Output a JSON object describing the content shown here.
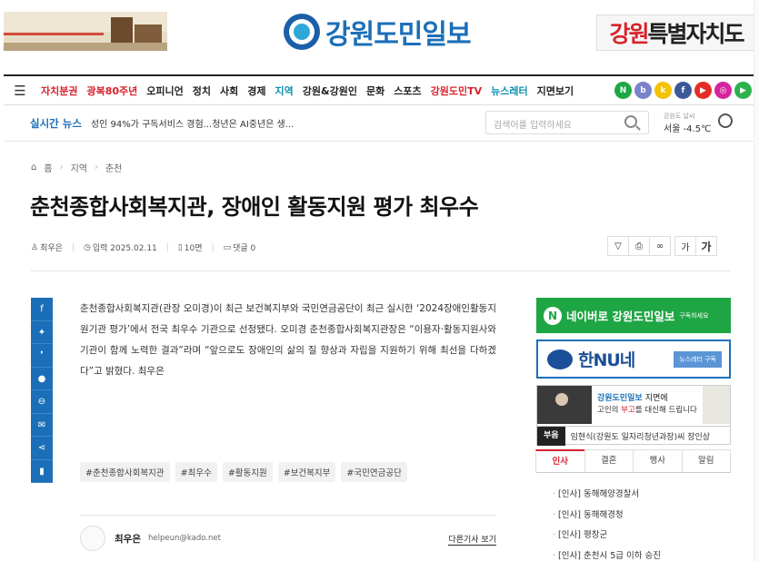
{
  "banners": {
    "left_caption": "",
    "right_text_red": "강원",
    "right_text": "특별자치도"
  },
  "logo": {
    "name": "강원도민일보"
  },
  "nav": {
    "menu": [
      {
        "label": "자치분권",
        "tone": "red"
      },
      {
        "label": "광복80주년",
        "tone": "red"
      },
      {
        "label": "오피니언",
        "tone": "dark"
      },
      {
        "label": "정치",
        "tone": "dark"
      },
      {
        "label": "사회",
        "tone": "dark"
      },
      {
        "label": "경제",
        "tone": "dark"
      },
      {
        "label": "지역",
        "tone": "teal"
      },
      {
        "label": "강원&강원인",
        "tone": "dark"
      },
      {
        "label": "문화",
        "tone": "dark"
      },
      {
        "label": "스포츠",
        "tone": "dark"
      },
      {
        "label": "강원도민TV",
        "tone": "red"
      },
      {
        "label": "뉴스레터",
        "tone": "teal"
      },
      {
        "label": "지면보기",
        "tone": "dark"
      }
    ],
    "socials": [
      {
        "icon": "naver-icon",
        "glyph": "N",
        "color": "#1fa644"
      },
      {
        "icon": "band-icon",
        "glyph": "b",
        "color": "#7a83c9"
      },
      {
        "icon": "kakaostory-icon",
        "glyph": "k",
        "color": "#f3c200"
      },
      {
        "icon": "facebook-icon",
        "glyph": "f",
        "color": "#3b5998"
      },
      {
        "icon": "youtube-icon",
        "glyph": "▶",
        "color": "#e52d27"
      },
      {
        "icon": "instagram-icon",
        "glyph": "◎",
        "color": "#d6249f"
      },
      {
        "icon": "play-icon",
        "glyph": "▶",
        "color": "#2bb24c"
      }
    ]
  },
  "ticker": {
    "label": "실시간 뉴스",
    "headline": "성인 94%가 구독서비스 경험...청년은 AI중년은 생...",
    "search_placeholder": "검색어를 입력하세요",
    "weather_small": "강원도 날씨",
    "weather": "서울 -4.5℃"
  },
  "breadcrumb": {
    "home": "홈",
    "section": "지역",
    "sub": "춘천"
  },
  "article": {
    "title": "춘천종합사회복지관, 장애인 활동지원 평가 최우수",
    "reporter": "최우은",
    "date": "입력 2025.02.11",
    "minutes": "10면",
    "comments": "댓글 0",
    "body": "춘천종합사회복지관(관장 오미경)이 최근 보건복지부와 국민연금공단이 최근 실시한 ‘2024장애인활동지원기관 평가’에서 전국 최우수 기관으로 선정됐다. 오미경 춘천종합사회복지관장은 “이용자·활동지원사와 기관이 함께 노력한 결과”라며 “앞으로도 장애인의 삶의 질 향상과 자립을 지원하기 위해 최선을 다하겠다”고 밝혔다. 최우은",
    "tags": [
      "#춘천종합사회복지관",
      "#최우수",
      "#활동지원",
      "#보건복지부",
      "#국민연금공단"
    ],
    "author_name": "최우은",
    "author_email": "helpeun@kado.net",
    "more_link": "다른기사 보기"
  },
  "tools": {
    "font_small": "가",
    "font_large": "가"
  },
  "sidebar": {
    "naver_title": "네이버로 강원도민일보",
    "naver_sub": "구독하세요",
    "hannune": "한NU네",
    "hannune_btn": "뉴스레터 구독",
    "obit_brand": "강원도민일보",
    "obit_line1": "지면에",
    "obit_line2_a": "고인의 ",
    "obit_line2_b": "부고",
    "obit_line2_c": "를 대신해 드립니다",
    "obit_key": "부음",
    "obit_value": "임현식(강원도 일자리청년과장)씨 장인상",
    "tabs": [
      "인사",
      "결혼",
      "행사",
      "알림"
    ],
    "list": [
      "[인사] 동해해양경찰서",
      "[인사] 동해해경청",
      "[인사] 평창군",
      "[인사] 춘천시 5급 이하 승진"
    ]
  }
}
